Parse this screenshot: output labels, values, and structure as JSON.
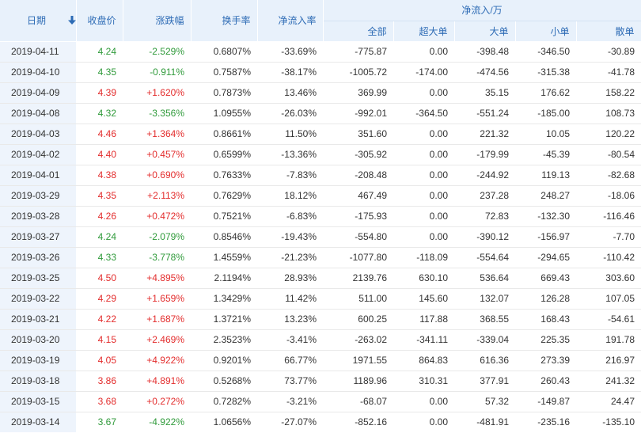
{
  "headers": {
    "date": "日期",
    "close": "收盘价",
    "change": "涨跌幅",
    "turnover": "换手率",
    "net_rate": "净流入率",
    "net_inflow_group": "净流入/万",
    "all": "全部",
    "xlarge": "超大单",
    "large": "大单",
    "small": "小单",
    "retail": "散单"
  },
  "icons": {
    "sort": "sort-down-arrow-icon"
  },
  "colors": {
    "up": "#e32c2c",
    "down": "#2f9a3a",
    "header_bg": "#e8f1fb",
    "header_text": "#2d6bb5",
    "date_bg": "#eef4fc"
  },
  "rows": [
    {
      "date": "2019-04-11",
      "close": "4.24",
      "change": "-2.529%",
      "turnover": "0.6807%",
      "net_rate": "-33.69%",
      "all": "-775.87",
      "xlarge": "0.00",
      "large": "-398.48",
      "small": "-346.50",
      "retail": "-30.89",
      "dir": "down"
    },
    {
      "date": "2019-04-10",
      "close": "4.35",
      "change": "-0.911%",
      "turnover": "0.7587%",
      "net_rate": "-38.17%",
      "all": "-1005.72",
      "xlarge": "-174.00",
      "large": "-474.56",
      "small": "-315.38",
      "retail": "-41.78",
      "dir": "down"
    },
    {
      "date": "2019-04-09",
      "close": "4.39",
      "change": "+1.620%",
      "turnover": "0.7873%",
      "net_rate": "13.46%",
      "all": "369.99",
      "xlarge": "0.00",
      "large": "35.15",
      "small": "176.62",
      "retail": "158.22",
      "dir": "up"
    },
    {
      "date": "2019-04-08",
      "close": "4.32",
      "change": "-3.356%",
      "turnover": "1.0955%",
      "net_rate": "-26.03%",
      "all": "-992.01",
      "xlarge": "-364.50",
      "large": "-551.24",
      "small": "-185.00",
      "retail": "108.73",
      "dir": "down"
    },
    {
      "date": "2019-04-03",
      "close": "4.46",
      "change": "+1.364%",
      "turnover": "0.8661%",
      "net_rate": "11.50%",
      "all": "351.60",
      "xlarge": "0.00",
      "large": "221.32",
      "small": "10.05",
      "retail": "120.22",
      "dir": "up"
    },
    {
      "date": "2019-04-02",
      "close": "4.40",
      "change": "+0.457%",
      "turnover": "0.6599%",
      "net_rate": "-13.36%",
      "all": "-305.92",
      "xlarge": "0.00",
      "large": "-179.99",
      "small": "-45.39",
      "retail": "-80.54",
      "dir": "up"
    },
    {
      "date": "2019-04-01",
      "close": "4.38",
      "change": "+0.690%",
      "turnover": "0.7633%",
      "net_rate": "-7.83%",
      "all": "-208.48",
      "xlarge": "0.00",
      "large": "-244.92",
      "small": "119.13",
      "retail": "-82.68",
      "dir": "up"
    },
    {
      "date": "2019-03-29",
      "close": "4.35",
      "change": "+2.113%",
      "turnover": "0.7629%",
      "net_rate": "18.12%",
      "all": "467.49",
      "xlarge": "0.00",
      "large": "237.28",
      "small": "248.27",
      "retail": "-18.06",
      "dir": "up"
    },
    {
      "date": "2019-03-28",
      "close": "4.26",
      "change": "+0.472%",
      "turnover": "0.7521%",
      "net_rate": "-6.83%",
      "all": "-175.93",
      "xlarge": "0.00",
      "large": "72.83",
      "small": "-132.30",
      "retail": "-116.46",
      "dir": "up"
    },
    {
      "date": "2019-03-27",
      "close": "4.24",
      "change": "-2.079%",
      "turnover": "0.8546%",
      "net_rate": "-19.43%",
      "all": "-554.80",
      "xlarge": "0.00",
      "large": "-390.12",
      "small": "-156.97",
      "retail": "-7.70",
      "dir": "down"
    },
    {
      "date": "2019-03-26",
      "close": "4.33",
      "change": "-3.778%",
      "turnover": "1.4559%",
      "net_rate": "-21.23%",
      "all": "-1077.80",
      "xlarge": "-118.09",
      "large": "-554.64",
      "small": "-294.65",
      "retail": "-110.42",
      "dir": "down"
    },
    {
      "date": "2019-03-25",
      "close": "4.50",
      "change": "+4.895%",
      "turnover": "2.1194%",
      "net_rate": "28.93%",
      "all": "2139.76",
      "xlarge": "630.10",
      "large": "536.64",
      "small": "669.43",
      "retail": "303.60",
      "dir": "up"
    },
    {
      "date": "2019-03-22",
      "close": "4.29",
      "change": "+1.659%",
      "turnover": "1.3429%",
      "net_rate": "11.42%",
      "all": "511.00",
      "xlarge": "145.60",
      "large": "132.07",
      "small": "126.28",
      "retail": "107.05",
      "dir": "up"
    },
    {
      "date": "2019-03-21",
      "close": "4.22",
      "change": "+1.687%",
      "turnover": "1.3721%",
      "net_rate": "13.23%",
      "all": "600.25",
      "xlarge": "117.88",
      "large": "368.55",
      "small": "168.43",
      "retail": "-54.61",
      "dir": "up"
    },
    {
      "date": "2019-03-20",
      "close": "4.15",
      "change": "+2.469%",
      "turnover": "2.3523%",
      "net_rate": "-3.41%",
      "all": "-263.02",
      "xlarge": "-341.11",
      "large": "-339.04",
      "small": "225.35",
      "retail": "191.78",
      "dir": "up"
    },
    {
      "date": "2019-03-19",
      "close": "4.05",
      "change": "+4.922%",
      "turnover": "0.9201%",
      "net_rate": "66.77%",
      "all": "1971.55",
      "xlarge": "864.83",
      "large": "616.36",
      "small": "273.39",
      "retail": "216.97",
      "dir": "up"
    },
    {
      "date": "2019-03-18",
      "close": "3.86",
      "change": "+4.891%",
      "turnover": "0.5268%",
      "net_rate": "73.77%",
      "all": "1189.96",
      "xlarge": "310.31",
      "large": "377.91",
      "small": "260.43",
      "retail": "241.32",
      "dir": "up"
    },
    {
      "date": "2019-03-15",
      "close": "3.68",
      "change": "+0.272%",
      "turnover": "0.7282%",
      "net_rate": "-3.21%",
      "all": "-68.07",
      "xlarge": "0.00",
      "large": "57.32",
      "small": "-149.87",
      "retail": "24.47",
      "dir": "up"
    },
    {
      "date": "2019-03-14",
      "close": "3.67",
      "change": "-4.922%",
      "turnover": "1.0656%",
      "net_rate": "-27.07%",
      "all": "-852.16",
      "xlarge": "0.00",
      "large": "-481.91",
      "small": "-235.16",
      "retail": "-135.10",
      "dir": "down"
    }
  ]
}
